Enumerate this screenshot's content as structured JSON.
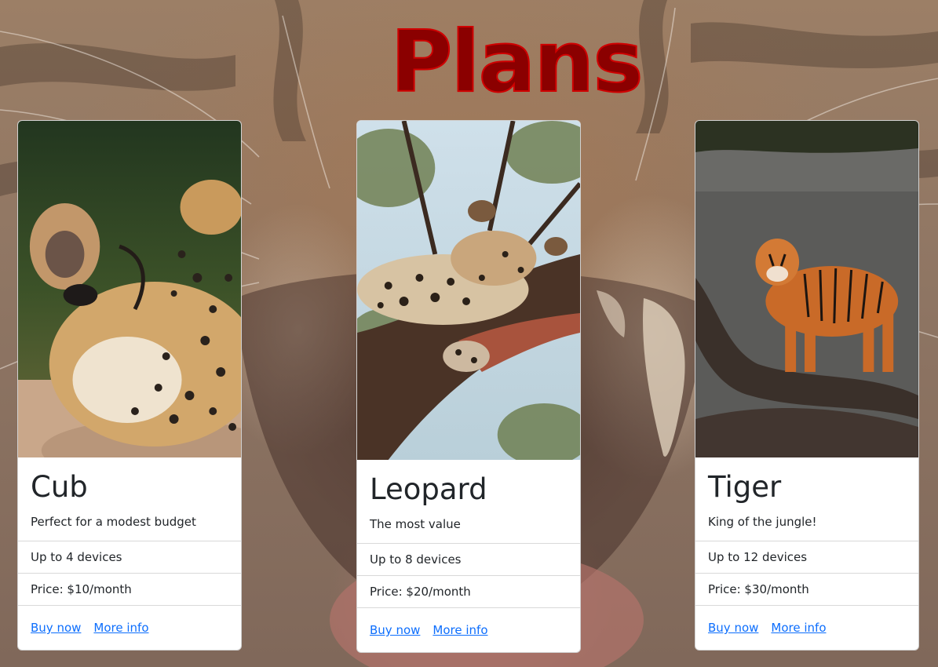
{
  "page": {
    "title": "Plans",
    "title_color": "#8b0000",
    "link_color": "#0d6efd"
  },
  "plans": [
    {
      "name": "Cub",
      "image": "cheetah-cub-photo",
      "description": "Perfect for a modest budget",
      "devices": "Up to 4 devices",
      "price": "Price: $10/month",
      "buy_label": "Buy now",
      "info_label": "More info"
    },
    {
      "name": "Leopard",
      "image": "leopard-photo",
      "description": "The most value",
      "devices": "Up to 8 devices",
      "price": "Price: $20/month",
      "buy_label": "Buy now",
      "info_label": "More info"
    },
    {
      "name": "Tiger",
      "image": "tiger-photo",
      "description": "King of the jungle!",
      "devices": "Up to 12 devices",
      "price": "Price: $30/month",
      "buy_label": "Buy now",
      "info_label": "More info"
    }
  ]
}
